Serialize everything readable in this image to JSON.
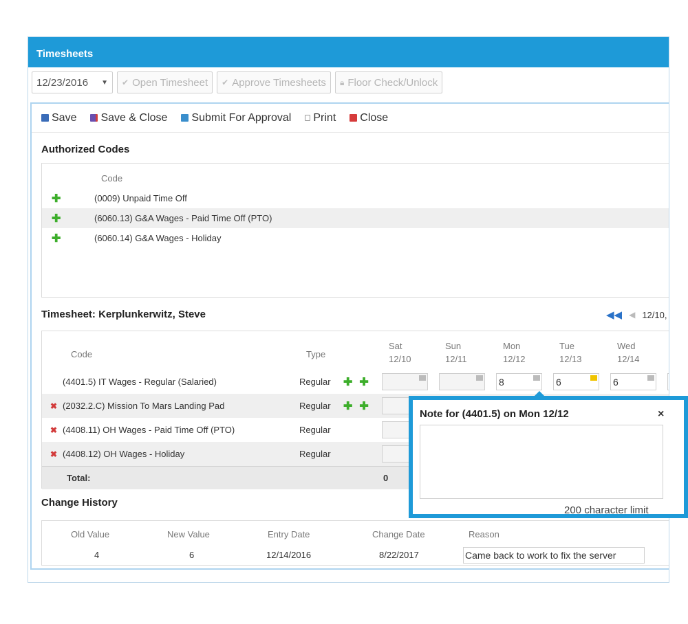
{
  "window": {
    "title": "Timesheets"
  },
  "toolbar": {
    "date": "12/23/2016",
    "open_timesheet": "Open Timesheet",
    "approve_timesheets": "Approve Timesheets",
    "floor_check": "Floor Check/Unlock"
  },
  "actions": {
    "save": "Save",
    "save_close": "Save & Close",
    "submit": "Submit For Approval",
    "print": "Print",
    "close": "Close"
  },
  "authorized_codes": {
    "title": "Authorized Codes",
    "column": "Code",
    "rows": [
      "(0009) Unpaid Time Off",
      "(6060.13) G&A Wages - Paid Time Off (PTO)",
      "(6060.14) G&A Wages - Holiday"
    ]
  },
  "timesheet": {
    "title": "Timesheet: Kerplunkerwitz, Steve",
    "pager_date": "12/10,",
    "columns": {
      "code": "Code",
      "type": "Type"
    },
    "days": [
      {
        "day": "Sat",
        "date": "12/10"
      },
      {
        "day": "Sun",
        "date": "12/11"
      },
      {
        "day": "Mon",
        "date": "12/12"
      },
      {
        "day": "Tue",
        "date": "12/13"
      },
      {
        "day": "Wed",
        "date": "12/14"
      }
    ],
    "rows": [
      {
        "code": "(4401.5) IT Wages - Regular (Salaried)",
        "type": "Regular",
        "hours": [
          "",
          "",
          "8",
          "6",
          "6"
        ]
      },
      {
        "code": "(2032.2.C) Mission To Mars Landing Pad",
        "type": "Regular",
        "hours": [
          "",
          "",
          "",
          "",
          ""
        ]
      },
      {
        "code": "(4408.11) OH Wages - Paid Time Off (PTO)",
        "type": "Regular",
        "hours": [
          "",
          "",
          "",
          "",
          ""
        ]
      },
      {
        "code": "(4408.12) OH Wages - Holiday",
        "type": "Regular",
        "hours": [
          "",
          "",
          "",
          "",
          ""
        ]
      }
    ],
    "total_label": "Total:",
    "total_sat": "0"
  },
  "history": {
    "title": "Change History",
    "headers": [
      "Old Value",
      "New Value",
      "Entry Date",
      "Change Date",
      "Reason"
    ],
    "row": {
      "old_value": "4",
      "new_value": "6",
      "entry_date": "12/14/2016",
      "change_date": "8/22/2017",
      "reason": "Came back to work to fix the server"
    }
  },
  "note": {
    "title": "Note for (4401.5) on Mon 12/12",
    "close": "×",
    "limit": "200 character limit"
  },
  "colors": {
    "accent": "#1e9ad8",
    "add": "#3dae2b",
    "remove": "#d23a3a"
  }
}
